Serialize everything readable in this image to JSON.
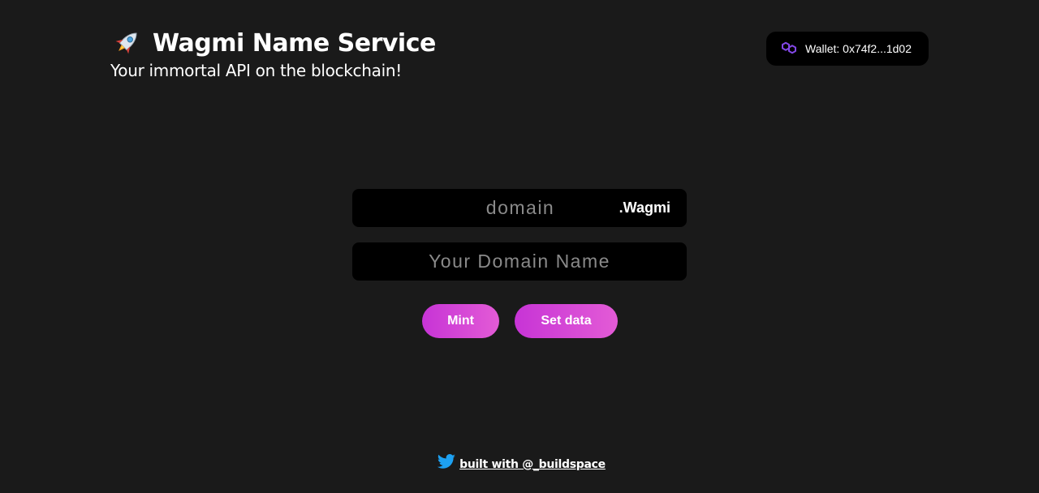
{
  "header": {
    "title": "Wagmi Name Service",
    "subtitle": "Your immortal API on the blockchain!",
    "icon": "rocket-icon"
  },
  "wallet": {
    "label": "Wallet: 0x74f2...1d02",
    "icon": "polygon-icon",
    "icon_color": "#8247e5"
  },
  "form": {
    "domain_placeholder": "domain",
    "domain_value": "",
    "tld": ".Wagmi",
    "record_placeholder": "Your Domain Name",
    "record_value": ""
  },
  "buttons": {
    "mint_label": "Mint",
    "set_data_label": "Set data",
    "gradient_start": "#c734d6",
    "gradient_end": "#e35bd6"
  },
  "footer": {
    "link_text": "built with @_buildspace",
    "icon": "twitter-icon",
    "icon_color": "#1da1f2"
  },
  "colors": {
    "background": "#1a1a1a",
    "field_background": "#000000",
    "text": "#ffffff",
    "placeholder": "#8a8a8a"
  }
}
